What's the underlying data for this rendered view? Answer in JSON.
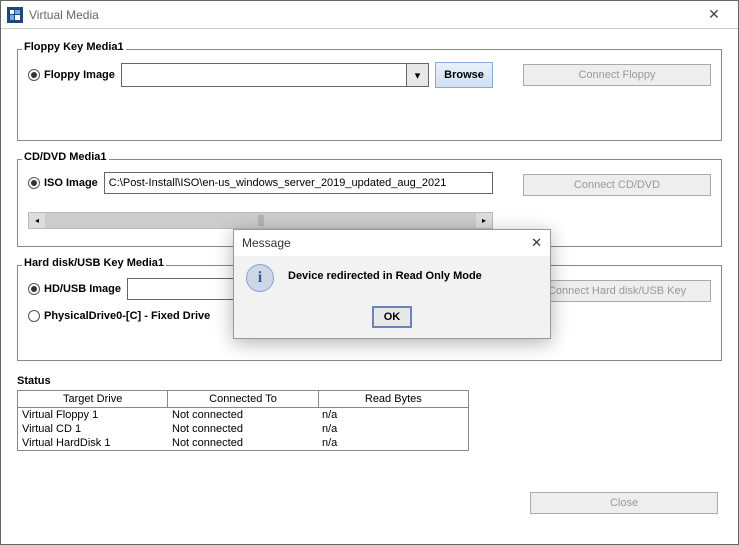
{
  "window": {
    "title": "Virtual Media"
  },
  "floppy": {
    "panel_label": "Floppy Key Media1",
    "radio_label": "Floppy Image",
    "image_path": "",
    "browse_label": "Browse",
    "connect_label": "Connect Floppy"
  },
  "cddvd": {
    "panel_label": "CD/DVD Media1",
    "radio_label": "ISO Image",
    "image_path": "C:\\Post-Install\\ISO\\en-us_windows_server_2019_updated_aug_2021",
    "connect_label": "Connect CD/DVD"
  },
  "hdusb": {
    "panel_label": "Hard disk/USB Key Media1",
    "radio_label": "HD/USB Image",
    "image_path": "",
    "phys_label": "PhysicalDrive0-[C] - Fixed Drive",
    "connect_label": "Connect Hard disk/USB Key"
  },
  "status": {
    "title": "Status",
    "headers": {
      "target": "Target Drive",
      "connected": "Connected To",
      "bytes": "Read Bytes"
    },
    "rows": [
      {
        "target": "Virtual Floppy 1",
        "connected": "Not connected",
        "bytes": "n/a"
      },
      {
        "target": "Virtual CD 1",
        "connected": "Not connected",
        "bytes": "n/a"
      },
      {
        "target": "Virtual HardDisk 1",
        "connected": "Not connected",
        "bytes": "n/a"
      }
    ]
  },
  "close_label": "Close",
  "modal": {
    "title": "Message",
    "text": "Device redirected in Read Only Mode",
    "ok_label": "OK"
  }
}
